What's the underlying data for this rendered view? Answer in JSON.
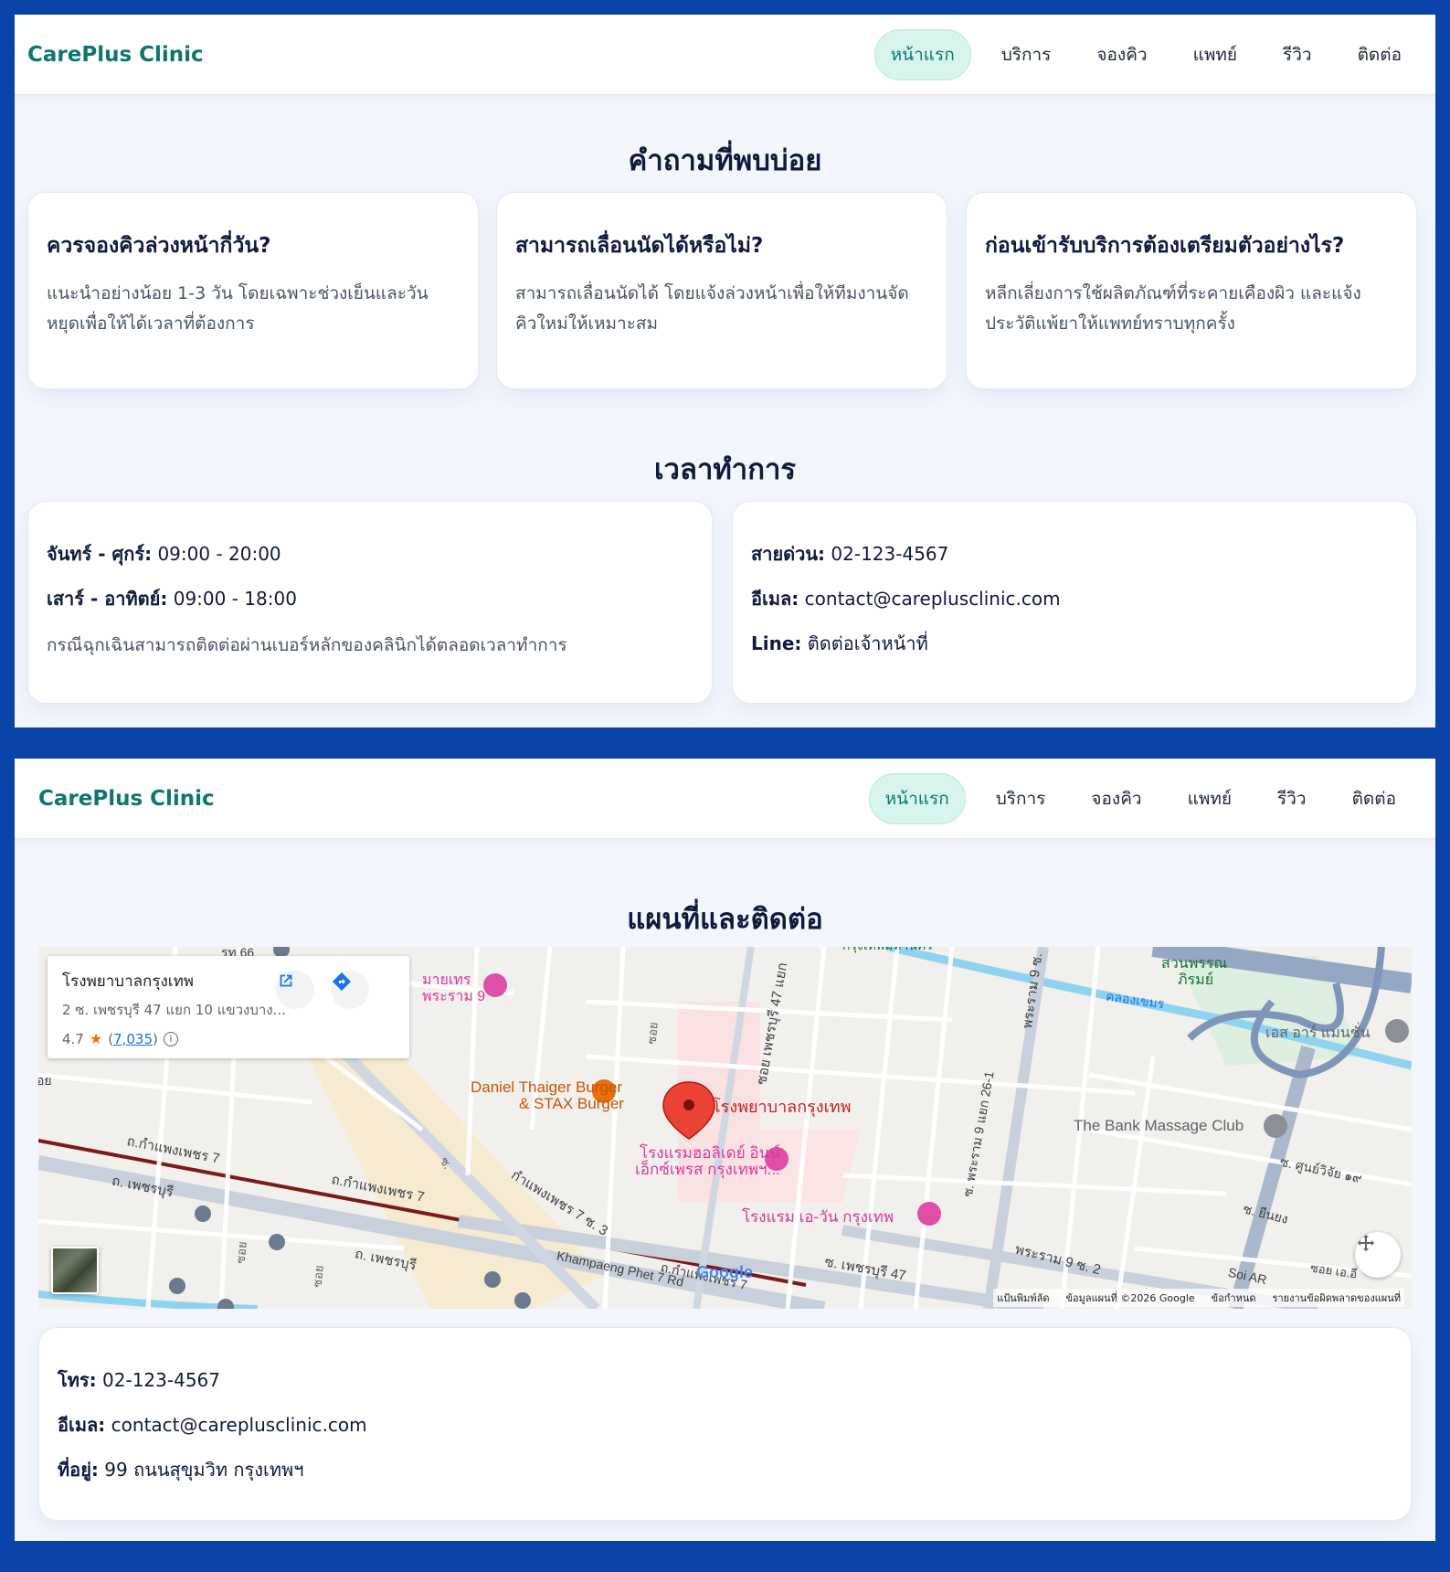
{
  "nav": {
    "brand": "CarePlus Clinic",
    "links": [
      "หน้าแรก",
      "บริการ",
      "จองคิว",
      "แพทย์",
      "รีวิว",
      "ติดต่อ"
    ],
    "active_index": 0
  },
  "faq": {
    "title": "คำถามที่พบบ่อย",
    "items": [
      {
        "q": "ควรจองคิวล่วงหน้ากี่วัน?",
        "a": "แนะนำอย่างน้อย 1-3 วัน โดยเฉพาะช่วงเย็นและวันหยุดเพื่อให้ได้เวลาที่ต้องการ"
      },
      {
        "q": "สามารถเลื่อนนัดได้หรือไม่?",
        "a": "สามารถเลื่อนนัดได้ โดยแจ้งล่วงหน้าเพื่อให้ทีมงานจัดคิวใหม่ให้เหมาะสม"
      },
      {
        "q": "ก่อนเข้ารับบริการต้องเตรียมตัวอย่างไร?",
        "a": "หลีกเลี่ยงการใช้ผลิตภัณฑ์ที่ระคายเคืองผิว และแจ้งประวัติแพ้ยาให้แพทย์ทราบทุกครั้ง"
      }
    ]
  },
  "hours": {
    "title": "เวลาทำการ",
    "weekday_label": "จันทร์ - ศุกร์:",
    "weekday_value": "09:00 - 20:00",
    "weekend_label": "เสาร์ - อาทิตย์:",
    "weekend_value": "09:00 - 18:00",
    "note": "กรณีฉุกเฉินสามารถติดต่อผ่านเบอร์หลักของคลินิกได้ตลอดเวลาทำการ",
    "hotline_label": "สายด่วน:",
    "hotline_value": "02-123-4567",
    "email_label": "อีเมล:",
    "email_value": "contact@careplusclinic.com",
    "line_label": "Line:",
    "line_value": "ติดต่อเจ้าหน้าที่"
  },
  "map_section": {
    "title": "แผนที่และติดต่อ",
    "place_card": {
      "name": "โรงพยาบาลกรุงเทพ",
      "address": "2 ซ. เพชรบุรี 47 แยก 10 แขวงบาง...",
      "rating": "4.7",
      "reviews": "7,035"
    },
    "labels": {
      "hospital": "โรงพยาบาลกรุงเทพ",
      "burger_1": "Daniel Thaiger Burger",
      "burger_2": "& STAX Burger",
      "holiday_1": "โรงแรมฮอลิเดย์ อินน์",
      "holiday_2": "เอ็กซ์เพรส กรุงเทพฯ...",
      "aone": "โรงแรม เอ-วัน กรุงเทพ",
      "bank_massage": "The Bank Massage Club",
      "hotel_top_1": "มายเทร",
      "hotel_top_2": "พระราม 9",
      "park_1": "สวนพรรณ",
      "park_2": "ภิรมย์",
      "canal": "คลองเขมร",
      "es_art": "เอส อาร์ แมนชั่น",
      "phetchaburi": "ถ. เพชรบุรี",
      "phetchaburi_2": "ถ. เพชรบุรี",
      "kamphaeng_1": "ถ.กำแพงเพชร 7",
      "kamphaeng_2": "ถ.กำแพงเพชร 7",
      "kamphaeng_3": "กำแพงเพชร 7 ซ. 3",
      "kamphaeng_en": "Khampaeng Phet 7 Rd",
      "kamphaeng_4": "ถ.กำแพงเพชร 7",
      "soi_phet47": "ซอย เพชรบุรี 47 แยก",
      "phet47": "ซ. เพชรบุรี 47",
      "rama9_vert": "พระราม 9 ซ.",
      "rama9_26": "ซ. พระราม 9 แยก 26-1",
      "rama9_bottom": "พระราม 9 ซ. 2",
      "soi_center": "ซอย",
      "soi_left_1": "ซอย",
      "soi_left_2": "ซอย",
      "soi_ab": "ซ.",
      "soi_right_1": "ซ. ศูนย์วิจัย ๑๙",
      "soi_right_2": "ซ. ยืนยง",
      "soi_ar": "Soi AR",
      "soi_bottom_right": "ซอย เอ.อี",
      "top_left_road": "รท 66",
      "top_center_road": "กรุงเทพมหานคร",
      "left_edge": "อย"
    },
    "google": "Google",
    "attribution": [
      "แป้นพิมพ์ลัด",
      "ข้อมูลแผนที่ ©2026 Google",
      "ข้อกำหนด",
      "รายงานข้อผิดพลาดของแผนที่"
    ],
    "contact": {
      "phone_label": "โทร:",
      "phone_value": "02-123-4567",
      "email_label": "อีเมล:",
      "email_value": "contact@careplusclinic.com",
      "address_label": "ที่อยู่:",
      "address_value": "99 ถนนสุขุมวิท กรุงเทพฯ"
    }
  },
  "colors": {
    "frame": "#0b44a8",
    "brand": "#0f766e",
    "active_pill": "#d7f5ec",
    "page_bg": "#f3f6fc",
    "map_marker": "#ea4335",
    "poi_pink": "#e04ea7",
    "poi_orange": "#e8710a"
  },
  "icons": [
    "open-in-new-icon",
    "directions-icon",
    "info-icon",
    "star-icon",
    "fullscreen-icon",
    "map-pin-icon",
    "hotel-icon",
    "restaurant-icon",
    "bus-icon",
    "place-icon"
  ]
}
